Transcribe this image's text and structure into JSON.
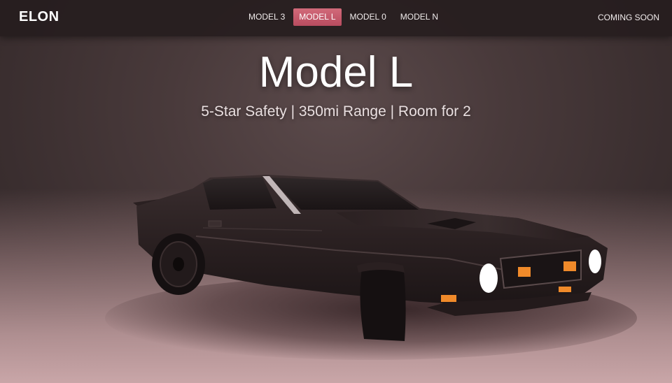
{
  "nav": {
    "logo": "ELON",
    "links": [
      {
        "label": "MODEL 3",
        "active": false
      },
      {
        "label": "MODEL L",
        "active": true
      },
      {
        "label": "MODEL 0",
        "active": false
      },
      {
        "label": "MODEL N",
        "active": false
      }
    ],
    "right_link": "COMING SOON",
    "accent_color": "#c85a6c"
  },
  "hero": {
    "title": "Model L",
    "subtitle": "5-Star Safety | 350mi Range | Room for 2",
    "image": "car-icon"
  },
  "colors": {
    "background": "#4a3b3c",
    "floor": "#c9a6a8",
    "car_body": "#2b2223",
    "indicator_lights": "#f08a2a"
  }
}
